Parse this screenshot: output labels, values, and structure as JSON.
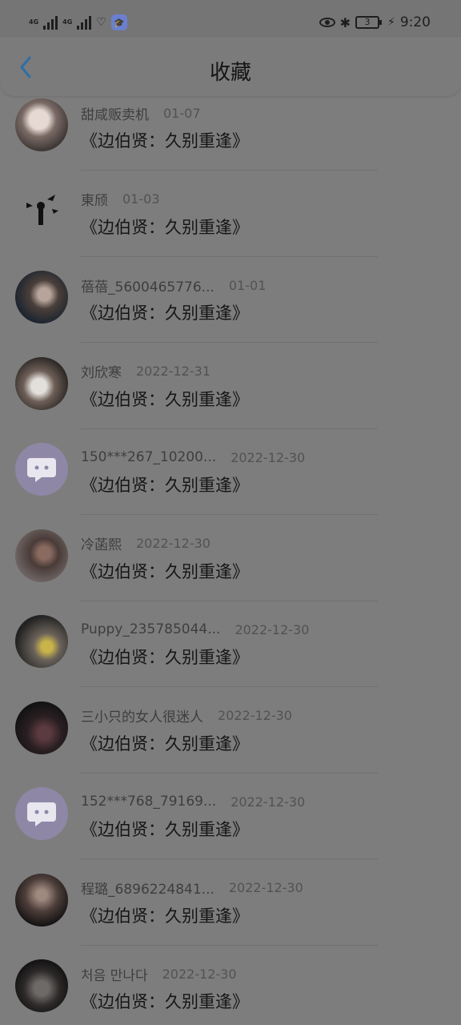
{
  "status_bar": {
    "net_1": "4G",
    "net_2": "4G",
    "battery": "3",
    "time": "9:20",
    "icons": [
      "signal-icon",
      "signal-icon",
      "wifi-icon",
      "app-badge-icon",
      "eye-icon",
      "bluetooth-icon",
      "battery-icon",
      "charging-icon"
    ]
  },
  "header": {
    "title": "收藏",
    "back_icon": "chevron-left-icon"
  },
  "colors": {
    "overlay_gray": "#7d7d7d",
    "back_blue": "#2f6ea8",
    "default_avatar": "#8f87a6"
  },
  "items": [
    {
      "name": "甜咸贩卖机",
      "date": "01-07",
      "book": "《边伯贤：久别重逢》"
    },
    {
      "name": "東颀",
      "date": "01-03",
      "book": "《边伯贤：久别重逢》"
    },
    {
      "name": "蓓蓓_5600465776...",
      "date": "01-01",
      "book": "《边伯贤：久别重逢》"
    },
    {
      "name": "刘欣寒",
      "date": "2022-12-31",
      "book": "《边伯贤：久别重逢》"
    },
    {
      "name": "150***267_10200...",
      "date": "2022-12-30",
      "book": "《边伯贤：久别重逢》"
    },
    {
      "name": "冷菡熙",
      "date": "2022-12-30",
      "book": "《边伯贤：久别重逢》"
    },
    {
      "name": "Puppy_235785044...",
      "date": "2022-12-30",
      "book": "《边伯贤：久别重逢》"
    },
    {
      "name": "三小只的女人很迷人",
      "date": "2022-12-30",
      "book": "《边伯贤：久别重逢》"
    },
    {
      "name": "152***768_79169...",
      "date": "2022-12-30",
      "book": "《边伯贤：久别重逢》"
    },
    {
      "name": "程璐_6896224841...",
      "date": "2022-12-30",
      "book": "《边伯贤：久别重逢》"
    },
    {
      "name": "처음 만나다",
      "date": "2022-12-30",
      "book": "《边伯贤：久别重逢》"
    }
  ]
}
